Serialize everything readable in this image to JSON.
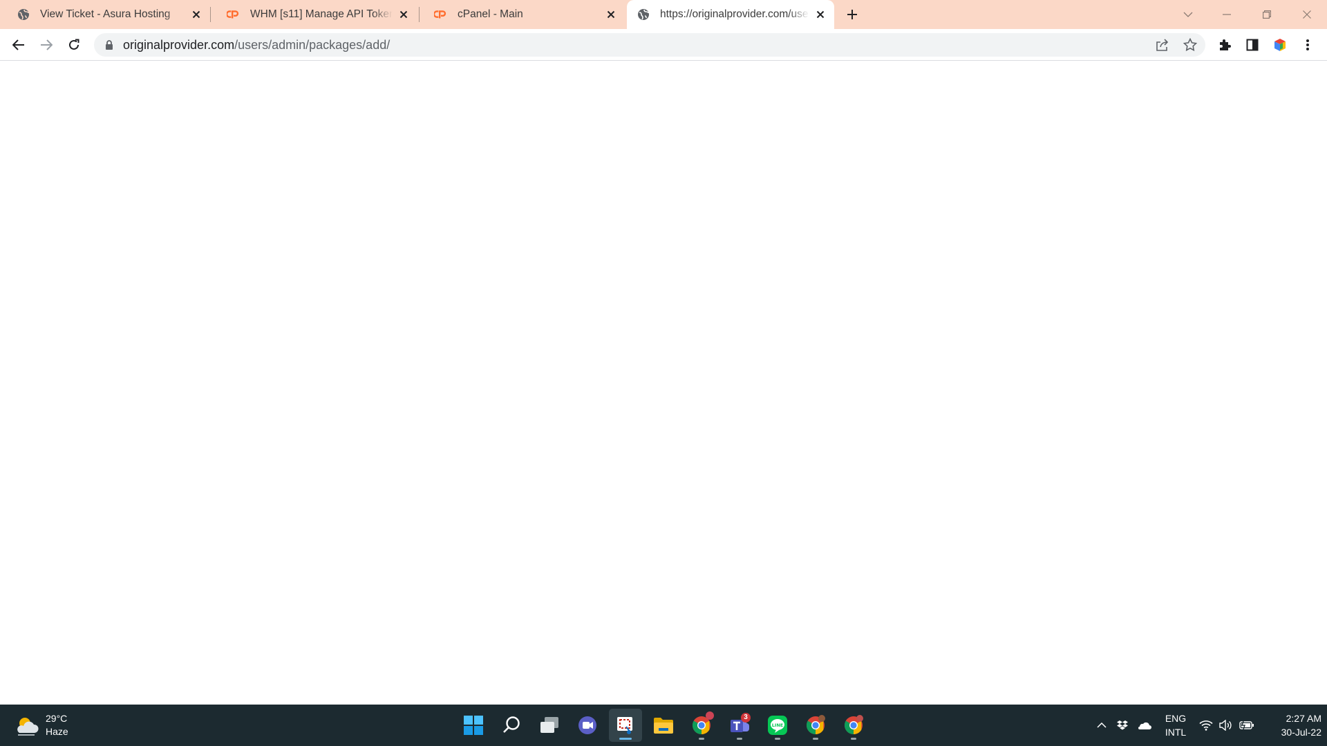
{
  "browser": {
    "tabs": [
      {
        "title": "View Ticket - Asura Hosting",
        "favicon": "globe-icon",
        "active": false
      },
      {
        "title": "WHM [s11] Manage API Tokens - ",
        "favicon": "cpanel-logo-icon",
        "active": false
      },
      {
        "title": "cPanel - Main",
        "favicon": "cpanel-logo-icon",
        "active": false
      },
      {
        "title": "https://originalprovider.com/users/admin/packages/add/",
        "favicon": "globe-icon",
        "active": true
      }
    ],
    "address_bar": {
      "host": "originalprovider.com",
      "path": "/users/admin/packages/add/"
    },
    "colors": {
      "tabstrip_bg": "#fbd8c7",
      "omnibox_bg": "#f1f3f4",
      "cpanel_orange": "#ff6c2c"
    }
  },
  "taskbar": {
    "weather": {
      "temp": "29°C",
      "condition": "Haze"
    },
    "pinned_apps": [
      "windows-start-icon",
      "search-icon",
      "task-view-icon",
      "teams-chat-icon",
      "snipping-tool-icon",
      "file-explorer-icon",
      "chrome-icon",
      "teams-icon",
      "line-icon",
      "chrome-profile-icon",
      "chrome-profile-icon"
    ],
    "teams_badge": "3",
    "language": {
      "line1": "ENG",
      "line2": "INTL"
    },
    "clock": {
      "time": "2:27 AM",
      "date": "30-Jul-22"
    },
    "colors": {
      "bg": "#1c2a30"
    }
  }
}
